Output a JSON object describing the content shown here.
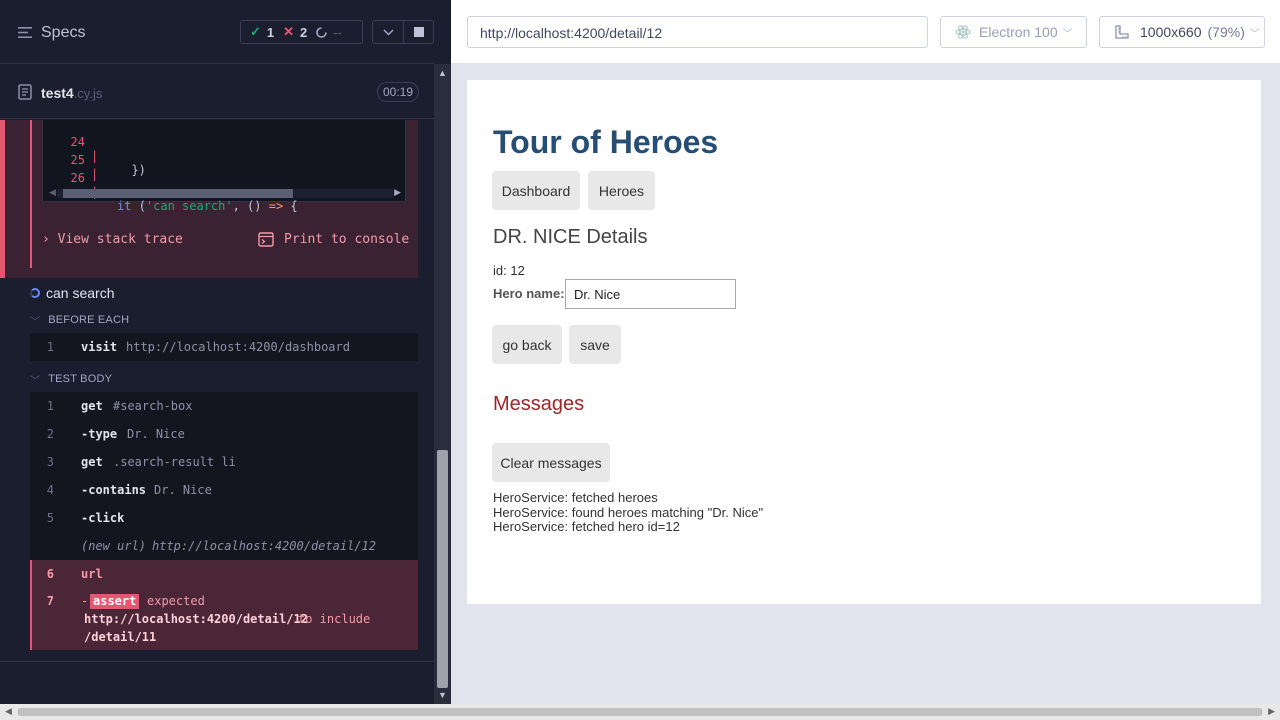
{
  "reporter": {
    "title": "Specs",
    "stats": {
      "passed": "1",
      "failed": "2",
      "pending": "--",
      "pass_glyph": "✓",
      "fail_glyph": "✕"
    },
    "file": {
      "name": "test4",
      "ext": ".cy.js",
      "duration": "00:19"
    },
    "code_frame": [
      {
        "ln": "24",
        "text": "  })"
      },
      {
        "ln": "25",
        "text": ""
      },
      {
        "ln": "26",
        "kw": "it",
        "str": "'can search'",
        "rest": ", () ",
        "arrow": "=>",
        "end": " {"
      }
    ],
    "view_stack_trace": "View stack trace",
    "print_to_console": "Print to console",
    "test_title": "can search",
    "before_each": {
      "label": "BEFORE EACH",
      "commands": [
        {
          "n": "1",
          "name": "visit",
          "arg": "http://localhost:4200/dashboard"
        }
      ]
    },
    "test_body": {
      "label": "TEST BODY",
      "commands": [
        {
          "n": "1",
          "name": "get",
          "arg": "#search-box"
        },
        {
          "n": "2",
          "name": "-type",
          "arg": "Dr. Nice"
        },
        {
          "n": "3",
          "name": "get",
          "arg": ".search-result li"
        },
        {
          "n": "4",
          "name": "-contains",
          "arg": "Dr. Nice"
        },
        {
          "n": "5",
          "name": "-click",
          "arg": ""
        },
        {
          "n": "",
          "name": "(new url)",
          "arg": "http://localhost:4200/detail/12"
        },
        {
          "n": "6",
          "name": "url",
          "arg": ""
        }
      ],
      "assert": {
        "n": "7",
        "dash": "-",
        "badge": "assert",
        "expected": "expected",
        "actual": "http://localhost:4200/detail/12",
        "to_include": "to include",
        "target": "/detail/11"
      }
    }
  },
  "runner": {
    "url": "http://localhost:4200/detail/12",
    "browser": "Electron 100",
    "viewport": "1000x660",
    "zoom": "(79%)"
  },
  "app": {
    "title": "Tour of Heroes",
    "nav": {
      "dashboard": "Dashboard",
      "heroes": "Heroes"
    },
    "details_heading": "DR. NICE Details",
    "id_line": "id: 12",
    "hero_name_label": "Hero name:",
    "hero_name_value": "Dr. Nice",
    "go_back": "go back",
    "save": "save",
    "messages_heading": "Messages",
    "clear_messages": "Clear messages",
    "messages": [
      "HeroService: fetched heroes",
      "HeroService: found heroes matching \"Dr. Nice\"",
      "HeroService: fetched hero id=12"
    ]
  },
  "colors": {
    "reporter_bg": "#1b1e2e",
    "pass": "#1fa971",
    "fail": "#e45770",
    "app_title": "#264d73",
    "messages_heading": "#a0252a"
  },
  "icons": {
    "menu": "menu-icon",
    "file": "document-icon",
    "chevron": "chevron-down-icon",
    "stop": "stop-icon",
    "pending": "pending-spinner-icon",
    "browser": "electron-icon",
    "viewport": "ruler-icon",
    "print": "console-icon"
  }
}
